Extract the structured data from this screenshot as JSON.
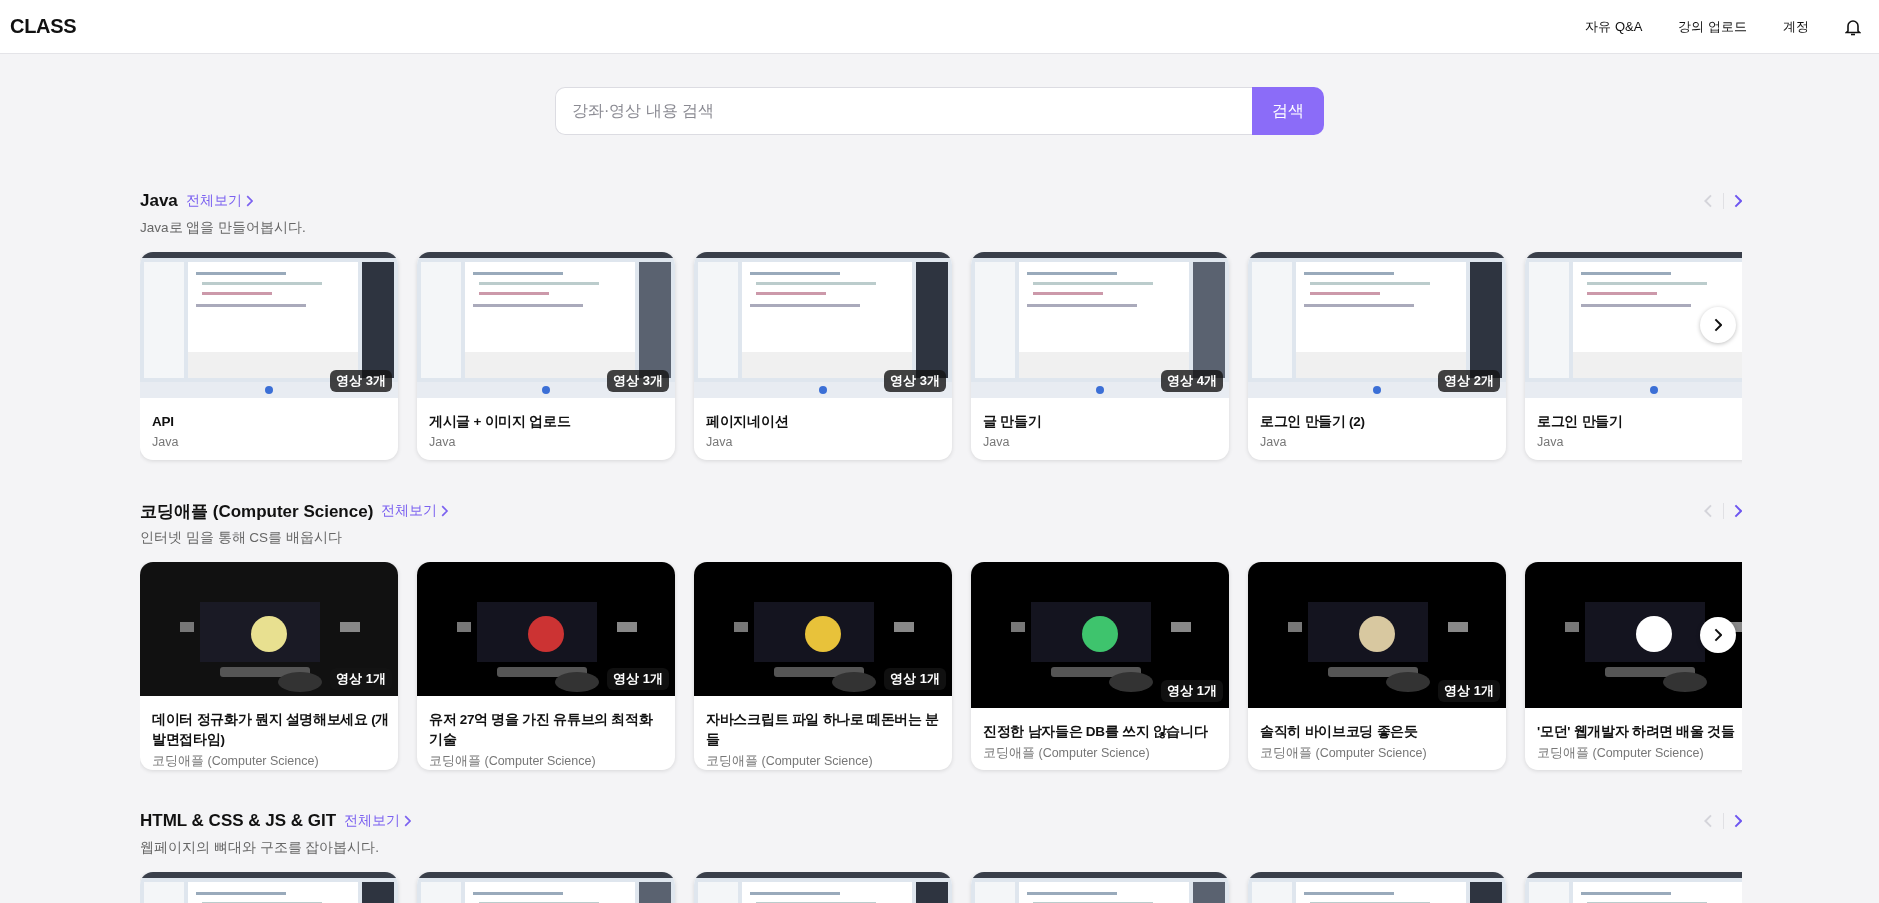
{
  "header": {
    "logo": "CLASS",
    "nav": [
      "자유 Q&A",
      "강의 업로드",
      "계정"
    ]
  },
  "search": {
    "placeholder": "강좌·영상 내용 검색",
    "button": "검색"
  },
  "sections": [
    {
      "title": "Java",
      "view_all": "전체보기",
      "description": "Java로 앱을 만들어봅시다.",
      "prev_enabled": false,
      "next_enabled": true,
      "overlay_next": true,
      "cards": [
        {
          "kind": "full",
          "title": "API",
          "subtitle": "Java",
          "badge": "영상 3개"
        },
        {
          "kind": "full",
          "title": "게시글 + 이미지 업로드",
          "subtitle": "Java",
          "badge": "영상 3개"
        },
        {
          "kind": "full",
          "title": "페이지네이션",
          "subtitle": "Java",
          "badge": "영상 3개"
        },
        {
          "kind": "full",
          "title": "글 만들기",
          "subtitle": "Java",
          "badge": "영상 4개"
        },
        {
          "kind": "full",
          "title": "로그인 만들기 (2)",
          "subtitle": "Java",
          "badge": "영상 2개"
        },
        {
          "kind": "full",
          "title": "로그인 만들기",
          "subtitle": "Java"
        }
      ]
    },
    {
      "title": "코딩애플 (Computer Science)",
      "view_all": "전체보기",
      "description": "인터넷 밈을 통해 CS를 배웁시다",
      "prev_enabled": false,
      "next_enabled": true,
      "overlay_next": true,
      "cards": [
        {
          "kind": "full",
          "title": "데이터 정규화가 뭔지 설명해보세요 (개발면접타임)",
          "subtitle": "코딩애플 (Computer Science)",
          "badge": "영상 1개"
        },
        {
          "kind": "full",
          "title": "유저 27억 명을 가진 유튜브의 최적화 기술",
          "subtitle": "코딩애플 (Computer Science)",
          "badge": "영상 1개"
        },
        {
          "kind": "full",
          "title": "자바스크립트 파일 하나로 떼돈버는 분들",
          "subtitle": "코딩애플 (Computer Science)",
          "badge": "영상 1개"
        },
        {
          "kind": "full",
          "title": "진정한 남자들은 DB를 쓰지 않습니다",
          "subtitle": "코딩애플 (Computer Science)",
          "badge": "영상 1개"
        },
        {
          "kind": "full",
          "title": "솔직히 바이브코딩 좋은듯",
          "subtitle": "코딩애플 (Computer Science)",
          "badge": "영상 1개"
        },
        {
          "kind": "full",
          "title": "'모던' 웹개발자 하려면 배울 것들",
          "subtitle": "코딩애플 (Computer Science)"
        }
      ]
    },
    {
      "title": "HTML & CSS & JS & GIT",
      "view_all": "전체보기",
      "description": "웹페이지의 뼈대와 구조를 잡아봅시다.",
      "prev_enabled": false,
      "next_enabled": true
    }
  ]
}
